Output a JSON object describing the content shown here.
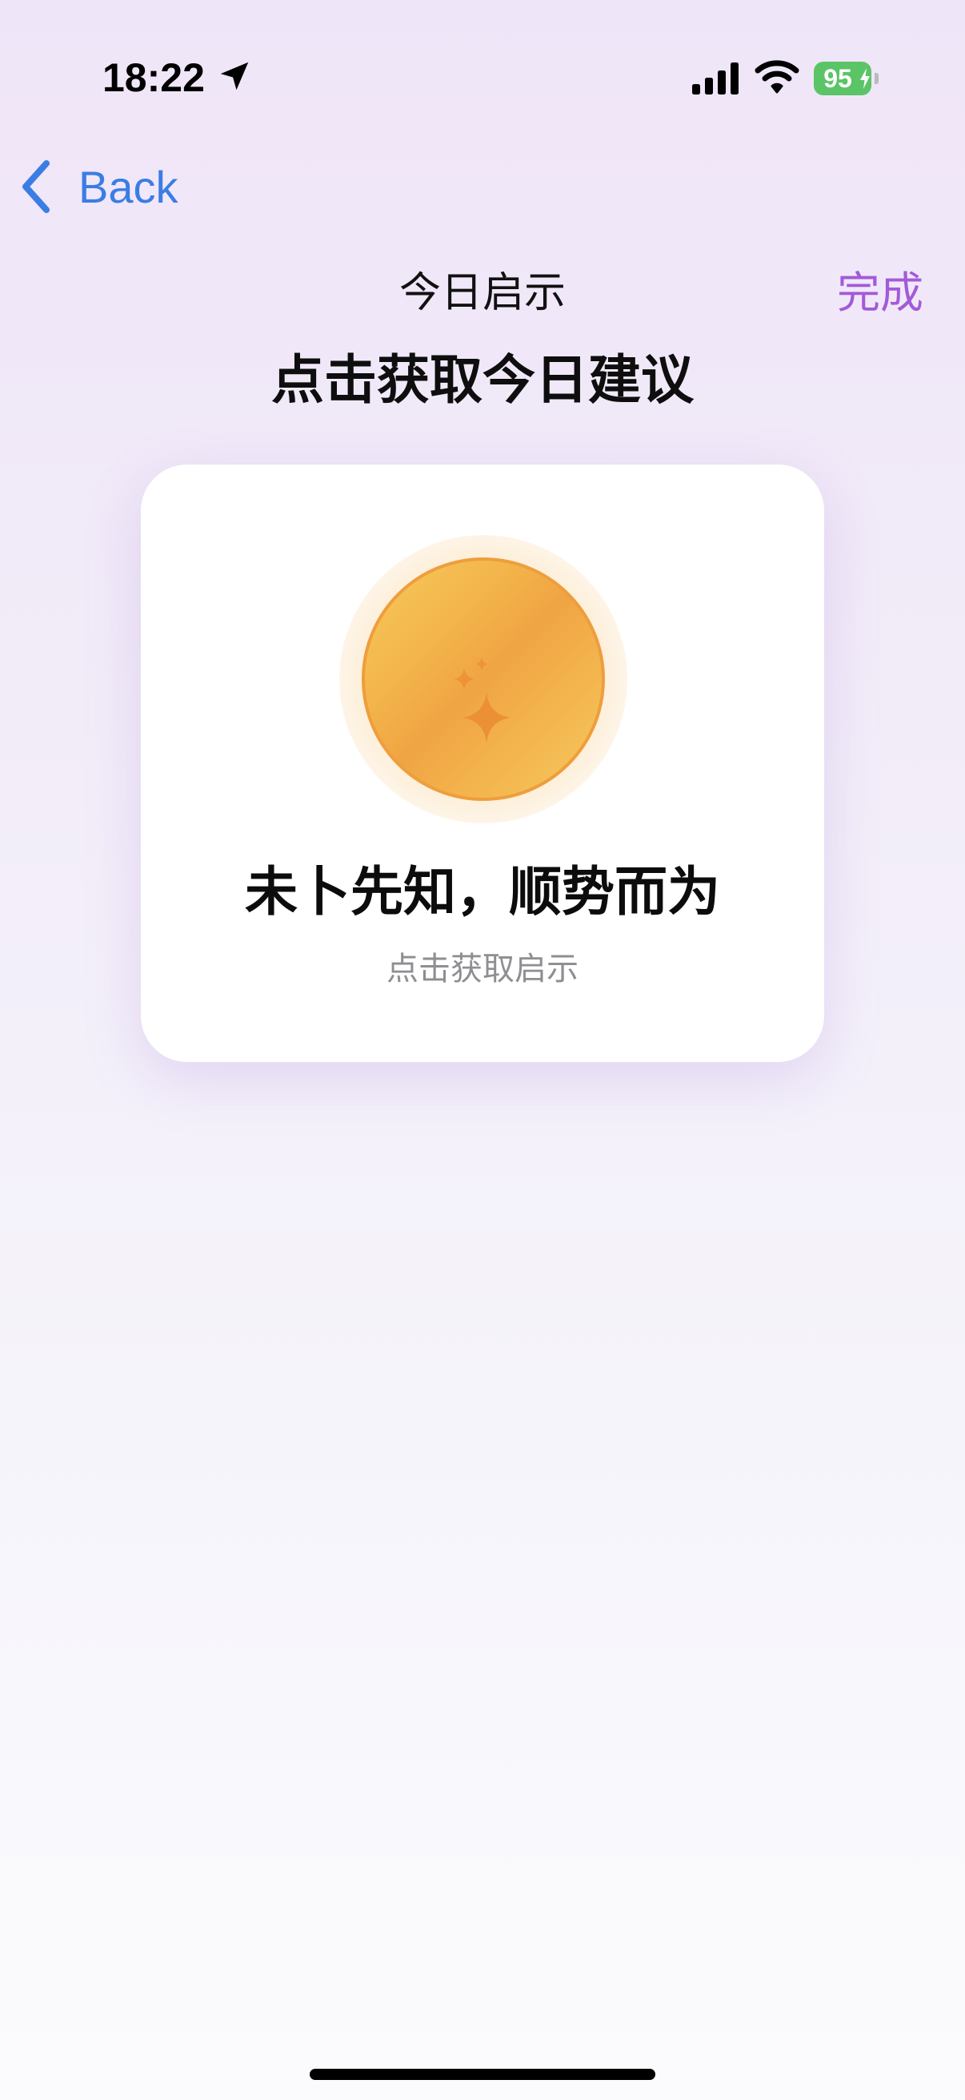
{
  "status_bar": {
    "time": "18:22",
    "battery_level": "95",
    "icons": [
      "location-arrow-icon",
      "cellular-signal-icon",
      "wifi-icon",
      "battery-charging-icon"
    ]
  },
  "nav": {
    "back_label": "Back",
    "back_icon": "chevron-left-icon"
  },
  "header": {
    "title": "今日启示",
    "subtitle": "点击获取今日建议",
    "done_label": "完成"
  },
  "card": {
    "title": "未卜先知，顺势而为",
    "hint": "点击获取启示",
    "coin_icon": "sparkle-icon"
  },
  "colors": {
    "back_blue": "#3b7de4",
    "done_purple": "#a35ad9",
    "coin_gold": "#f3b54e",
    "coin_border": "#ee9e3c",
    "battery_green": "#5bc466"
  }
}
